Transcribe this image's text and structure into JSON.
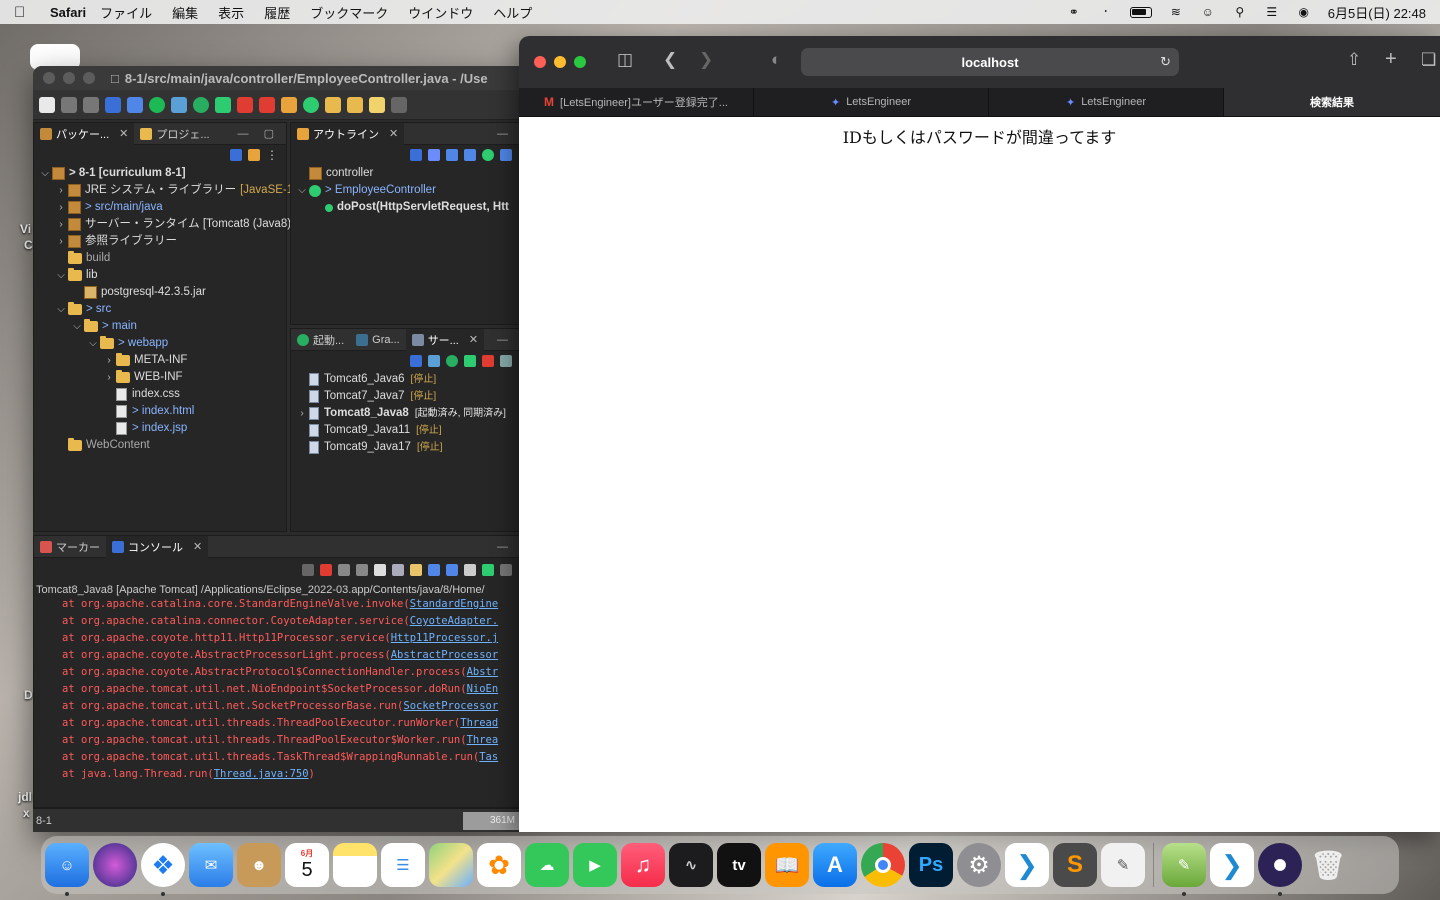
{
  "menubar": {
    "app": "Safari",
    "items": [
      "ファイル",
      "編集",
      "表示",
      "履歴",
      "ブックマーク",
      "ウインドウ",
      "ヘルプ"
    ],
    "clock": "6月5日(日) 22:48"
  },
  "desktop": {
    "labels": [
      "Vi",
      "C",
      "D",
      "jdl",
      "x"
    ]
  },
  "eclipse": {
    "title": "8-1/src/main/java/controller/EmployeeController.java - /Use",
    "package_pane": {
      "tabs": [
        "パッケー...",
        "プロジェ..."
      ],
      "tree": [
        {
          "indent": 0,
          "twisty": "v",
          "icon": "project",
          "label": "> 8-1 [curriculum 8-1]",
          "bold": true
        },
        {
          "indent": 1,
          "twisty": ">",
          "icon": "library",
          "label": "JRE システム・ライブラリー",
          "extra": "[JavaSE-1.8"
        },
        {
          "indent": 1,
          "twisty": ">",
          "icon": "package",
          "label": "> src/main/java",
          "style": "blueish"
        },
        {
          "indent": 1,
          "twisty": ">",
          "icon": "library",
          "label": "サーバー・ランタイム [Tomcat8 (Java8)"
        },
        {
          "indent": 1,
          "twisty": ">",
          "icon": "library",
          "label": "参照ライブラリー"
        },
        {
          "indent": 1,
          "twisty": "",
          "icon": "folder",
          "label": "build",
          "style": "muted"
        },
        {
          "indent": 1,
          "twisty": "v",
          "icon": "folder",
          "label": "lib"
        },
        {
          "indent": 2,
          "twisty": "",
          "icon": "jar",
          "label": "postgresql-42.3.5.jar"
        },
        {
          "indent": 1,
          "twisty": "v",
          "icon": "folder",
          "label": "> src",
          "style": "blueish"
        },
        {
          "indent": 2,
          "twisty": "v",
          "icon": "folder",
          "label": "> main",
          "style": "blueish"
        },
        {
          "indent": 3,
          "twisty": "v",
          "icon": "folder",
          "label": "> webapp",
          "style": "blueish"
        },
        {
          "indent": 4,
          "twisty": ">",
          "icon": "folder",
          "label": "META-INF"
        },
        {
          "indent": 4,
          "twisty": ">",
          "icon": "folder",
          "label": "WEB-INF"
        },
        {
          "indent": 4,
          "twisty": "",
          "icon": "file",
          "label": "index.css"
        },
        {
          "indent": 4,
          "twisty": "",
          "icon": "file",
          "label": "> index.html",
          "style": "blueish"
        },
        {
          "indent": 4,
          "twisty": "",
          "icon": "file",
          "label": "> index.jsp",
          "style": "blueish"
        },
        {
          "indent": 1,
          "twisty": "",
          "icon": "folder",
          "label": "WebContent",
          "style": "muted"
        }
      ]
    },
    "outline_pane": {
      "tab": "アウトライン",
      "tree": [
        {
          "indent": 0,
          "twisty": "",
          "icon": "package",
          "label": "controller"
        },
        {
          "indent": 0,
          "twisty": "v",
          "icon": "class",
          "label": "> EmployeeController",
          "style": "blueish"
        },
        {
          "indent": 1,
          "twisty": "",
          "icon": "method",
          "label": "doPost(HttpServletRequest, Htt",
          "bold": true
        }
      ]
    },
    "servers_pane": {
      "tabs": [
        "起動...",
        "Gra...",
        "サー..."
      ],
      "servers": [
        {
          "name": "Tomcat6_Java6",
          "state": "[停止]",
          "active": false
        },
        {
          "name": "Tomcat7_Java7",
          "state": "[停止]",
          "active": false
        },
        {
          "name": "Tomcat8_Java8",
          "state": "[起動済み, 同期済み]",
          "active": true
        },
        {
          "name": "Tomcat9_Java11",
          "state": "[停止]",
          "active": false
        },
        {
          "name": "Tomcat9_Java17",
          "state": "[停止]",
          "active": false
        }
      ]
    },
    "console_pane": {
      "tabs": [
        "マーカー",
        "コンソール"
      ],
      "header": "Tomcat8_Java8 [Apache Tomcat] /Applications/Eclipse_2022-03.app/Contents/java/8/Home/",
      "lines": [
        {
          "text": "at org.apache.catalina.core.StandardEngineValve.invoke(",
          "link": "StandardEngine"
        },
        {
          "text": "at org.apache.catalina.connector.CoyoteAdapter.service(",
          "link": "CoyoteAdapter."
        },
        {
          "text": "at org.apache.coyote.http11.Http11Processor.service(",
          "link": "Http11Processor.j"
        },
        {
          "text": "at org.apache.coyote.AbstractProcessorLight.process(",
          "link": "AbstractProcessor"
        },
        {
          "text": "at org.apache.coyote.AbstractProtocol$ConnectionHandler.process(",
          "link": "Abstr"
        },
        {
          "text": "at org.apache.tomcat.util.net.NioEndpoint$SocketProcessor.doRun(",
          "link": "NioEn"
        },
        {
          "text": "at org.apache.tomcat.util.net.SocketProcessorBase.run(",
          "link": "SocketProcessor"
        },
        {
          "text": "at org.apache.tomcat.util.threads.ThreadPoolExecutor.runWorker(",
          "link": "Thread"
        },
        {
          "text": "at org.apache.tomcat.util.threads.ThreadPoolExecutor$Worker.run(",
          "link": "Threa"
        },
        {
          "text": "at org.apache.tomcat.util.threads.TaskThread$WrappingRunnable.run(",
          "link": "Tas"
        },
        {
          "text": "at java.lang.Thread.run(",
          "link": "Thread.java:750",
          "tail": ")"
        }
      ]
    },
    "status": {
      "project": "8-1",
      "heap": "361M"
    }
  },
  "safari": {
    "url": "localhost",
    "tabs": [
      {
        "title": "[LetsEngineer]ユーザー登録完了...",
        "favicon": "gmail",
        "active": false
      },
      {
        "title": "LetsEngineer",
        "favicon": "le",
        "active": false
      },
      {
        "title": "LetsEngineer",
        "favicon": "le",
        "active": false
      },
      {
        "title": "検索結果",
        "favicon": "",
        "active": true
      }
    ],
    "page_text": "IDもしくはパスワードが間違ってます"
  },
  "dock": {
    "calendar_month": "6月",
    "calendar_day": "5",
    "apps": [
      "Finder",
      "Siri",
      "Safari",
      "Mail",
      "Contacts",
      "Calendar",
      "Notes",
      "Reminders",
      "Maps",
      "Photos",
      "Messages",
      "FaceTime",
      "Music",
      "Stocks",
      "TV",
      "Books",
      "App Store",
      "Chrome",
      "Photoshop",
      "System Preferences",
      "VS Code",
      "Sublime Text",
      "TextEdit",
      "Script Editor",
      "VS Code 2",
      "Eclipse",
      "Trash"
    ],
    "tv_label": "tv",
    "ps_label": "Ps"
  },
  "colors": {
    "close": "#ff5f57",
    "minimize": "#febc2e",
    "zoom": "#28c840",
    "console_error": "#ff5a5a",
    "console_link": "#6fb2ff"
  }
}
